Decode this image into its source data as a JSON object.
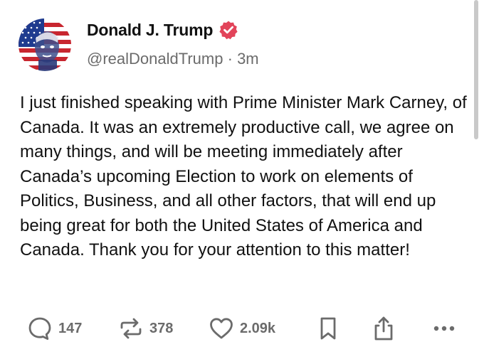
{
  "post": {
    "display_name": "Donald J. Trump",
    "handle": "@realDonaldTrump",
    "separator": "·",
    "time_ago": "3m",
    "body": "I just finished speaking with Prime Minister Mark Carney, of Canada. It was an extremely productive call, we agree on many things, and will be meeting immediately after Canada’s upcoming Election to work on elements of Politics, Business, and all other factors, that will end up being great for both the United States of America and Canada. Thank you for your attention to this matter!"
  },
  "actions": {
    "replies": "147",
    "retruths": "378",
    "likes": "2.09k"
  },
  "icons": {
    "avatar": "flag-portrait-avatar",
    "verified": "verified-badge-icon",
    "reply": "reply-icon",
    "retruth": "retruth-icon",
    "like": "heart-icon",
    "bookmark": "bookmark-icon",
    "share": "share-icon",
    "more": "more-icon"
  },
  "colors": {
    "verified_badge": "#e2445a",
    "text_primary": "#111111",
    "text_secondary": "#6b6b6b"
  }
}
